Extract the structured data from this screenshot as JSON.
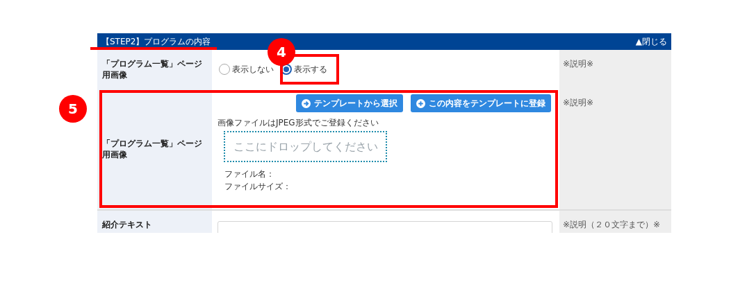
{
  "header": {
    "title": "【STEP2】プログラムの内容",
    "toggle": "▲閉じる"
  },
  "rows": [
    {
      "kind": "radio",
      "label": "「プログラム一覧」ページ用画像",
      "options": [
        {
          "label": "表示しない",
          "selected": false
        },
        {
          "label": "表示する",
          "selected": true
        }
      ],
      "note": "※説明※"
    },
    {
      "kind": "upload",
      "label": "「プログラム一覧」ページ用画像",
      "buttons": [
        {
          "label": "テンプレートから選択"
        },
        {
          "label": "この内容をテンプレートに登録"
        }
      ],
      "hint": "画像ファイルはJPEG形式でご登録ください",
      "dropzone": "ここにドロップしてください",
      "file_name": "ファイル名：",
      "file_size": "ファイルサイズ：",
      "note": "※説明※"
    },
    {
      "kind": "text",
      "label": "紹介テキスト",
      "note": "※説明（２０文字まで）※"
    }
  ],
  "annotations": [
    {
      "number": "4"
    },
    {
      "number": "5"
    }
  ]
}
